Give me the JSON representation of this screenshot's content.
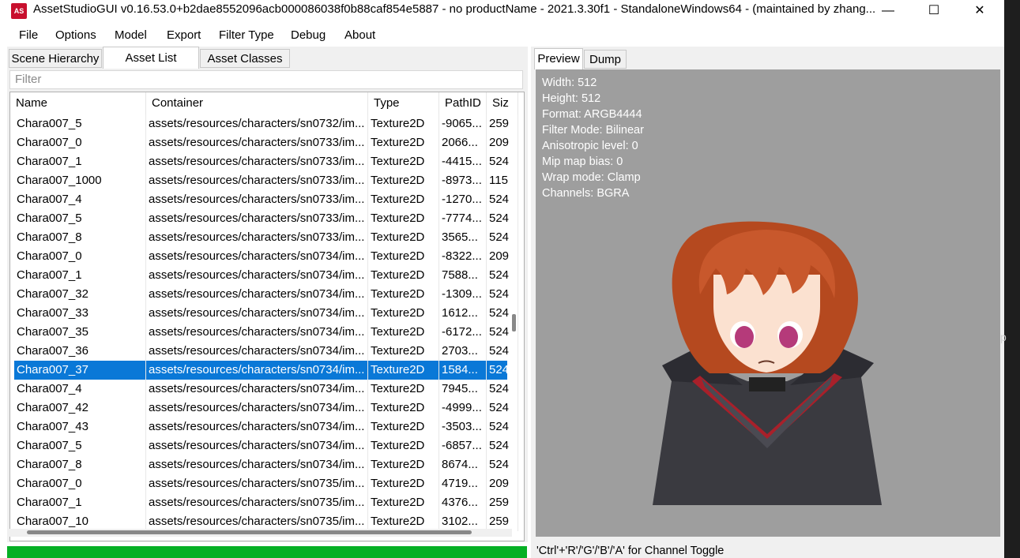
{
  "window": {
    "icon_text": "AS",
    "title": "AssetStudioGUI v0.16.53.0+b2dae8552096acb000086038f0b88caf854e5887 - no productName - 2021.3.30f1 - StandaloneWindows64 - (maintained by zhang...",
    "controls": {
      "minimize": "—",
      "maximize": "☐",
      "close": "✕"
    }
  },
  "menu": [
    "File",
    "Options",
    "Model",
    "Export",
    "Filter Type",
    "Debug",
    "About"
  ],
  "left_tabs": [
    {
      "label": "Scene Hierarchy",
      "active": false
    },
    {
      "label": "Asset List",
      "active": true
    },
    {
      "label": "Asset Classes",
      "active": false
    }
  ],
  "filter": {
    "placeholder": "Filter"
  },
  "columns": [
    "Name",
    "Container",
    "Type",
    "PathID",
    "Siz"
  ],
  "rows": [
    [
      "Chara007_5",
      "assets/resources/characters/sn0732/im...",
      "Texture2D",
      "-9065...",
      "259"
    ],
    [
      "Chara007_0",
      "assets/resources/characters/sn0733/im...",
      "Texture2D",
      "2066...",
      "209"
    ],
    [
      "Chara007_1",
      "assets/resources/characters/sn0733/im...",
      "Texture2D",
      "-4415...",
      "524"
    ],
    [
      "Chara007_1000",
      "assets/resources/characters/sn0733/im...",
      "Texture2D",
      "-8973...",
      "115"
    ],
    [
      "Chara007_4",
      "assets/resources/characters/sn0733/im...",
      "Texture2D",
      "-1270...",
      "524"
    ],
    [
      "Chara007_5",
      "assets/resources/characters/sn0733/im...",
      "Texture2D",
      "-7774...",
      "524"
    ],
    [
      "Chara007_8",
      "assets/resources/characters/sn0733/im...",
      "Texture2D",
      "3565...",
      "524"
    ],
    [
      "Chara007_0",
      "assets/resources/characters/sn0734/im...",
      "Texture2D",
      "-8322...",
      "209"
    ],
    [
      "Chara007_1",
      "assets/resources/characters/sn0734/im...",
      "Texture2D",
      "7588...",
      "524"
    ],
    [
      "Chara007_32",
      "assets/resources/characters/sn0734/im...",
      "Texture2D",
      "-1309...",
      "524"
    ],
    [
      "Chara007_33",
      "assets/resources/characters/sn0734/im...",
      "Texture2D",
      "1612...",
      "524"
    ],
    [
      "Chara007_35",
      "assets/resources/characters/sn0734/im...",
      "Texture2D",
      "-6172...",
      "524"
    ],
    [
      "Chara007_36",
      "assets/resources/characters/sn0734/im...",
      "Texture2D",
      "2703...",
      "524"
    ],
    [
      "Chara007_37",
      "assets/resources/characters/sn0734/im...",
      "Texture2D",
      "1584...",
      "524"
    ],
    [
      "Chara007_4",
      "assets/resources/characters/sn0734/im...",
      "Texture2D",
      "7945...",
      "524"
    ],
    [
      "Chara007_42",
      "assets/resources/characters/sn0734/im...",
      "Texture2D",
      "-4999...",
      "524"
    ],
    [
      "Chara007_43",
      "assets/resources/characters/sn0734/im...",
      "Texture2D",
      "-3503...",
      "524"
    ],
    [
      "Chara007_5",
      "assets/resources/characters/sn0734/im...",
      "Texture2D",
      "-6857...",
      "524"
    ],
    [
      "Chara007_8",
      "assets/resources/characters/sn0734/im...",
      "Texture2D",
      "8674...",
      "524"
    ],
    [
      "Chara007_0",
      "assets/resources/characters/sn0735/im...",
      "Texture2D",
      "4719...",
      "209"
    ],
    [
      "Chara007_1",
      "assets/resources/characters/sn0735/im...",
      "Texture2D",
      "4376...",
      "259"
    ],
    [
      "Chara007_10",
      "assets/resources/characters/sn0735/im...",
      "Texture2D",
      "3102...",
      "259"
    ]
  ],
  "selected_row": 13,
  "right_tabs": [
    {
      "label": "Preview",
      "active": true
    },
    {
      "label": "Dump",
      "active": false
    }
  ],
  "texture_info": [
    "Width: 512",
    "Height: 512",
    "Format: ARGB4444",
    "Filter Mode: Bilinear",
    "Anisotropic level: 0",
    "Mip map bias: 0",
    "Wrap mode: Clamp",
    "Channels: BGRA"
  ],
  "status_hint": "'Ctrl'+'R'/'G'/'B'/'A' for Channel Toggle",
  "edge_text": "p",
  "colors": {
    "selection": "#0a78d7",
    "progress": "#06b025",
    "preview_bg": "#9e9e9e",
    "hair": "#c8582c",
    "cape_dark": "#3a3a40",
    "cape_red": "#a8202a"
  }
}
